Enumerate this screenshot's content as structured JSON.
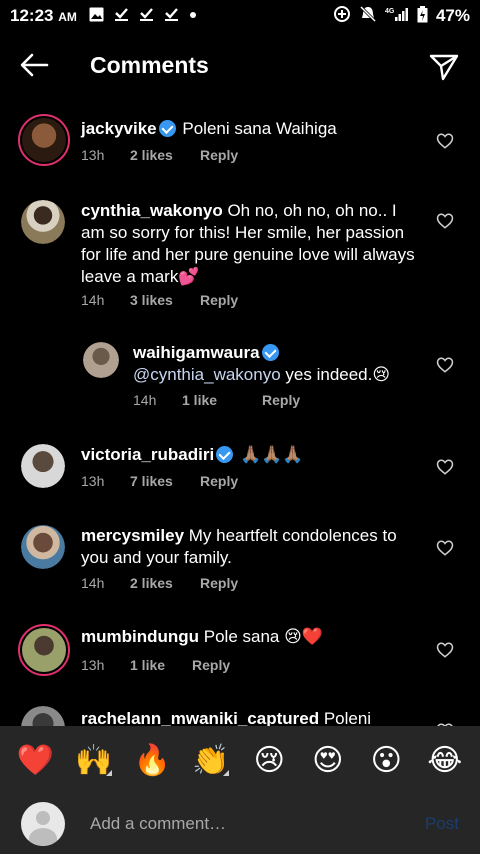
{
  "status_bar": {
    "time": "12:23",
    "ampm": "AM",
    "network": "4G",
    "battery": "47%"
  },
  "header": {
    "title": "Comments"
  },
  "comments": [
    {
      "username": "jackyvike",
      "verified": true,
      "text": "Poleni sana Waihiga",
      "time": "13h",
      "likes": "2 likes",
      "reply": "Reply",
      "avatar_color": "#6b4a2e"
    },
    {
      "username": "cynthia_wakonyo",
      "verified": false,
      "text": "Oh no, oh no, oh no.. I am so sorry for this! Her smile, her passion for life and her pure genuine love will always leave a mark💕",
      "time": "14h",
      "likes": "3 likes",
      "reply": "Reply",
      "avatar_color": "#8a7a5a"
    },
    {
      "username": "waihigamwaura",
      "verified": true,
      "mention": "@cynthia_wakonyo",
      "text": "yes indeed.😢",
      "time": "14h",
      "likes": "1 like",
      "reply": "Reply",
      "avatar_color": "#7a6a5a"
    },
    {
      "username": "victoria_rubadiri",
      "verified": true,
      "text": "🙏🏽🙏🏽🙏🏽",
      "time": "13h",
      "likes": "7 likes",
      "reply": "Reply",
      "avatar_color": "#5a4a3e"
    },
    {
      "username": "mercysmiley",
      "verified": false,
      "text": "My heartfelt condolences to you and your family.",
      "time": "14h",
      "likes": "2 likes",
      "reply": "Reply",
      "avatar_color": "#5a8ab0"
    },
    {
      "username": "mumbindungu",
      "verified": false,
      "text": "Pole sana 😢❤️",
      "time": "13h",
      "likes": "1 like",
      "reply": "Reply",
      "avatar_color": "#9aa06a"
    },
    {
      "username": "rachelann_mwaniki_captured",
      "verified": false,
      "text": "Poleni",
      "avatar_color": "#555555"
    }
  ],
  "emoji_bar": [
    "❤️",
    "🙌",
    "🔥",
    "👏",
    "😢",
    "😍",
    "😮",
    "😂"
  ],
  "add_comment": {
    "placeholder": "Add a comment…",
    "post_label": "Post"
  }
}
